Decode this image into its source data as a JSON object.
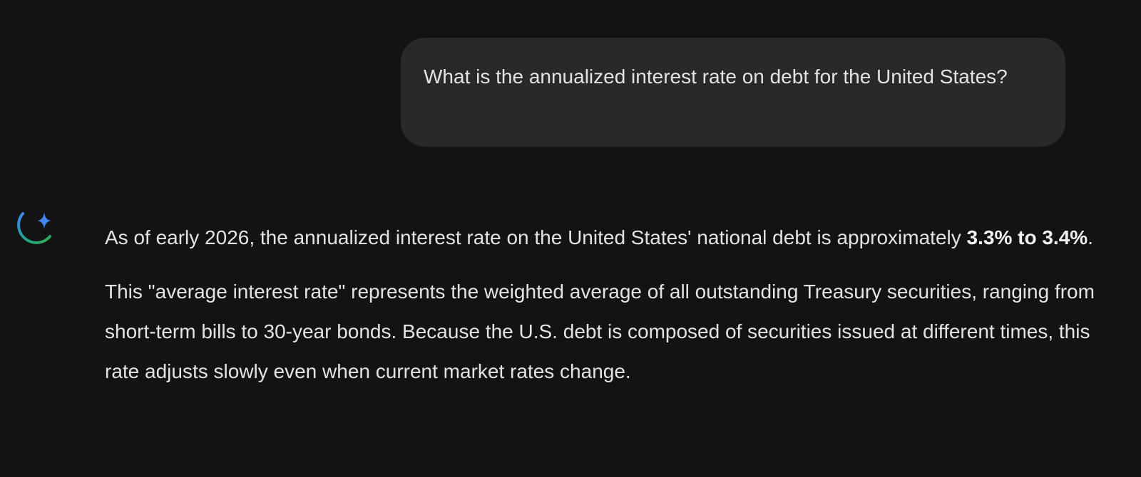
{
  "user_message": {
    "text": "What is the annualized interest rate on debt for the United States?"
  },
  "assistant": {
    "icon": "gemini-sparkle-icon",
    "colors": {
      "sparkle": "#4285f4",
      "arc_start": "#4285f4",
      "arc_end": "#34a853"
    },
    "paragraph1": {
      "text_before": "As of early 2026, the annualized interest rate on the United States' national debt is approximately ",
      "bold": "3.3% to 3.4%",
      "text_after": "."
    },
    "paragraph2": {
      "text": "This \"average interest rate\" represents the weighted average of all outstanding Treasury securities, ranging from short-term bills to 30-year bonds. Because the U.S. debt is composed of securities issued at different times, this rate adjusts slowly even when current market rates change."
    }
  },
  "colors": {
    "background": "#131314",
    "bubble": "#28292a",
    "text": "#e3e3e3"
  }
}
